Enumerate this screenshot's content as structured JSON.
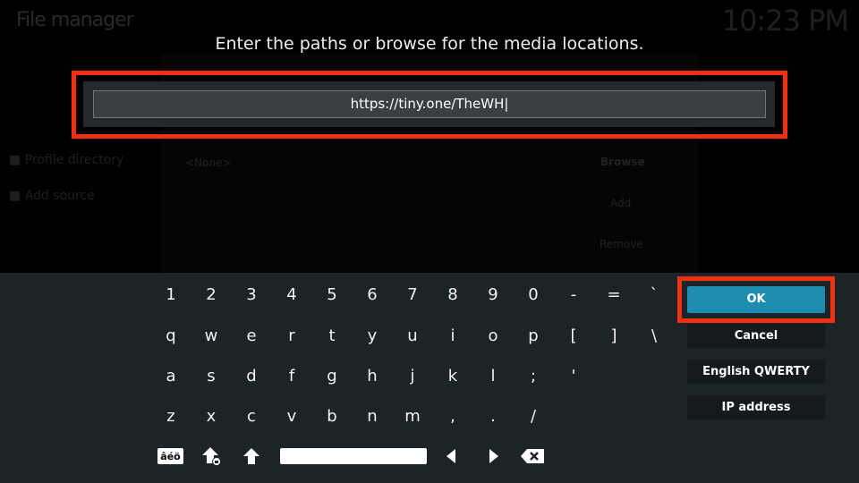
{
  "background": {
    "title": "File manager",
    "clock": "10:23 PM",
    "sidebar": [
      "Profile directory",
      "Add source"
    ],
    "list_value": "<None>",
    "buttons": [
      "Browse",
      "Add",
      "Remove"
    ]
  },
  "dialog": {
    "prompt": "Enter the paths or browse for the media locations.",
    "input_value": "https://tiny.one/TheWH|"
  },
  "keyboard": {
    "rows": [
      [
        "1",
        "2",
        "3",
        "4",
        "5",
        "6",
        "7",
        "8",
        "9",
        "0",
        "-",
        "=",
        "`"
      ],
      [
        "q",
        "w",
        "e",
        "r",
        "t",
        "y",
        "u",
        "i",
        "o",
        "p",
        "[",
        "]",
        "\\"
      ],
      [
        "a",
        "s",
        "d",
        "f",
        "g",
        "h",
        "j",
        "k",
        "l",
        ";",
        "'"
      ],
      [
        "z",
        "x",
        "c",
        "v",
        "b",
        "n",
        "m",
        ",",
        ".",
        "/"
      ]
    ],
    "accent_label": "âéö",
    "icons": [
      "accent-key",
      "caps-lock-icon",
      "shift-icon",
      "space-bar",
      "arrow-left-icon",
      "arrow-right-icon",
      "backspace-icon"
    ]
  },
  "side_buttons": {
    "ok": "OK",
    "cancel": "Cancel",
    "layout": "English QWERTY",
    "ip": "IP address"
  },
  "colors": {
    "highlight": "#f0300f",
    "ok": "#1c8cb0",
    "keyboard_bg": "#1d2428"
  }
}
